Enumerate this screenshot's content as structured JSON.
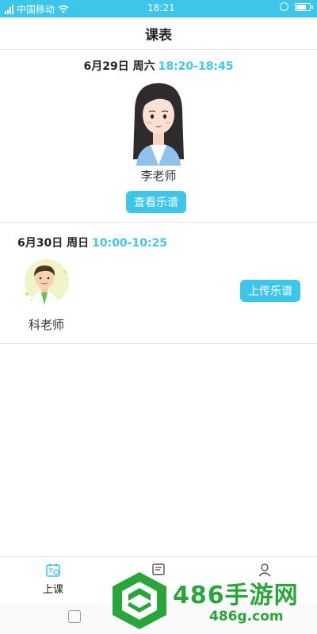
{
  "status_bar": {
    "carrier": "中国移动",
    "time": "18:21"
  },
  "header": {
    "title": "课表"
  },
  "lessons": [
    {
      "date": "6月29日 周六",
      "time": "18:20-18:45",
      "teacher": "李老师",
      "action_label": "查看乐谱",
      "avatar_icon": "female-teacher-avatar"
    },
    {
      "date": "6月30日 周日",
      "time": "10:00-10:25",
      "teacher": "科老师",
      "action_label": "上传乐谱",
      "avatar_icon": "male-teacher-avatar"
    }
  ],
  "tabbar": {
    "items": [
      {
        "label": "上课",
        "icon": "calendar-icon",
        "active": true
      },
      {
        "label": "",
        "icon": "notes-icon",
        "active": false
      },
      {
        "label": "",
        "icon": "profile-icon",
        "active": false
      }
    ]
  },
  "watermark": {
    "brand": "486手游网",
    "domain": "486g.com"
  },
  "colors": {
    "accent": "#3ec6ea",
    "watermark_green": "#2aa53a"
  }
}
